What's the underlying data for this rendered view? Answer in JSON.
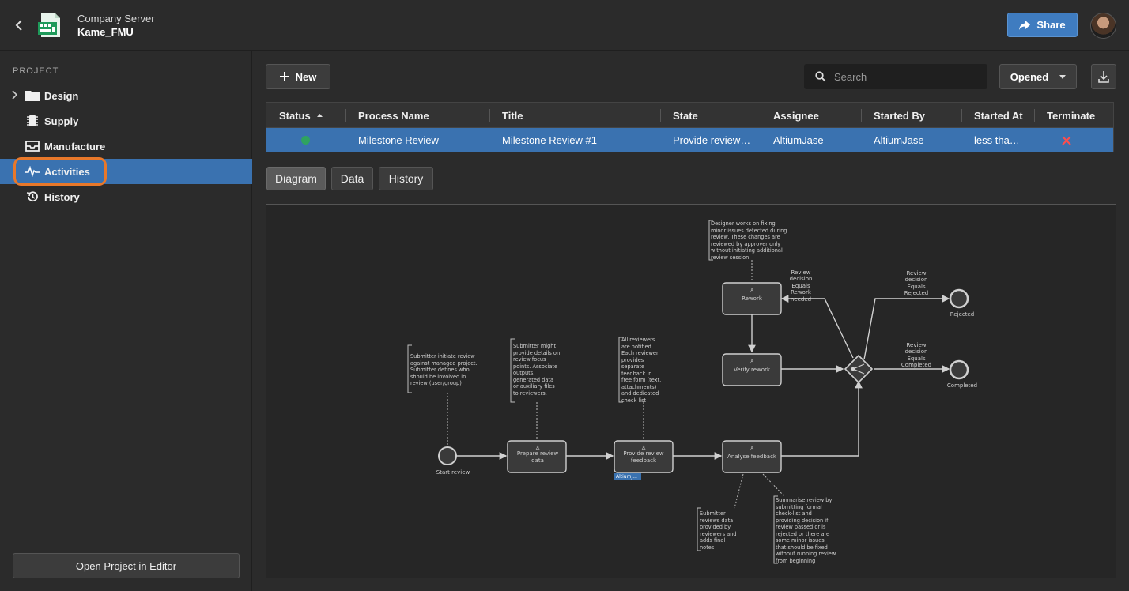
{
  "header": {
    "server_name": "Company Server",
    "project_name": "Kame_FMU",
    "share_label": "Share"
  },
  "sidebar": {
    "section_label": "PROJECT",
    "items": [
      {
        "label": "Design",
        "icon": "folder-icon",
        "expandable": true
      },
      {
        "label": "Supply",
        "icon": "chip-icon"
      },
      {
        "label": "Manufacture",
        "icon": "tray-icon"
      },
      {
        "label": "Activities",
        "icon": "activity-icon",
        "active": true
      },
      {
        "label": "History",
        "icon": "history-icon"
      }
    ],
    "open_editor_label": "Open Project in Editor"
  },
  "toolbar": {
    "new_label": "New",
    "search_placeholder": "Search",
    "filter_label": "Opened"
  },
  "table": {
    "columns": [
      "Status",
      "Process Name",
      "Title",
      "State",
      "Assignee",
      "Started By",
      "Started At",
      "Terminate"
    ],
    "rows": [
      {
        "status": "active",
        "process_name": "Milestone Review",
        "title": "Milestone Review #1",
        "state": "Provide review…",
        "assignee": "AltiumJase",
        "started_by": "AltiumJase",
        "started_at": "less tha…"
      }
    ]
  },
  "tabs": [
    "Diagram",
    "Data",
    "History"
  ],
  "diagram": {
    "nodes": {
      "start": "Start review",
      "prepare": [
        "Prepare review",
        "data"
      ],
      "provide": [
        "Provide review",
        "feedback"
      ],
      "provide_badge": "AltiumJ...",
      "analyse": "Analyse feedback",
      "rework": "Rework",
      "verify": "Verify rework",
      "rejected": "Rejected",
      "completed": "Completed"
    },
    "conditions": {
      "rework": [
        "Review",
        "decision",
        "Equals",
        "Rework",
        "needed"
      ],
      "rejected": [
        "Review",
        "decision",
        "Equals",
        "Rejected"
      ],
      "completed": [
        "Review",
        "decision",
        "Equals",
        "Completed"
      ]
    },
    "notes": {
      "start": [
        "Submitter initiate review",
        "against managed project.",
        "Submitter defines who",
        "should be involved in",
        "review (user/group)"
      ],
      "prepare": [
        "Submitter might",
        "provide details on",
        "review focus",
        "points. Associate",
        "outputs,",
        "generated data",
        "or auxiliary files",
        "to reviewers."
      ],
      "provide": [
        "All reviewers",
        "are notified.",
        "Each reviewer",
        "provides",
        "separate",
        "feedback in",
        "free form (text,",
        "attachments)",
        "and dedicated",
        "check list"
      ],
      "rework": [
        "Designer works on fixing",
        "minor issues detected during",
        "review. These changes are",
        "reviewed by approver only",
        "without initiating additional",
        "review session"
      ],
      "analyse_left": [
        "Submitter",
        "reviews data",
        "provided by",
        "reviewers and",
        "adds final",
        "notes"
      ],
      "analyse_right": [
        "Summarise review by",
        "submitting formal",
        "check-list and",
        "providing decision if",
        "review passed or is",
        "rejected or there are",
        "some minor issues",
        "that should be fixed",
        "without running review",
        "from beginning"
      ]
    }
  },
  "colors": {
    "accent": "#3a72b0",
    "highlight": "#e8782a",
    "status_ok": "#2fa360",
    "terminate": "#ff4d4d"
  }
}
